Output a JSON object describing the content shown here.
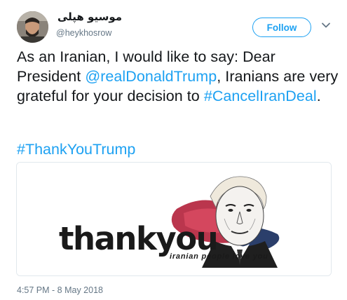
{
  "user": {
    "display_name": "موسیو هپلی",
    "handle": "@heykhosrow"
  },
  "follow_button": {
    "label": "Follow"
  },
  "menu": {
    "icon": "chevron-down-icon"
  },
  "tweet": {
    "text_parts": {
      "intro": "As an Iranian, I would like to say: Dear President ",
      "mention": "@realDonaldTrump",
      "middle": ", Iranians are very grateful for your decision to ",
      "hashtag1": "#CancelIranDeal",
      "end": "."
    },
    "hashtag2": "#ThankYouTrump",
    "timestamp": "4:57 PM - 8 May 2018"
  },
  "media": {
    "headline": "thankyou",
    "caption": "iranian people love you"
  },
  "colors": {
    "accent": "#1da1f2",
    "secondary_text": "#657786",
    "border": "#e1e8ed"
  }
}
